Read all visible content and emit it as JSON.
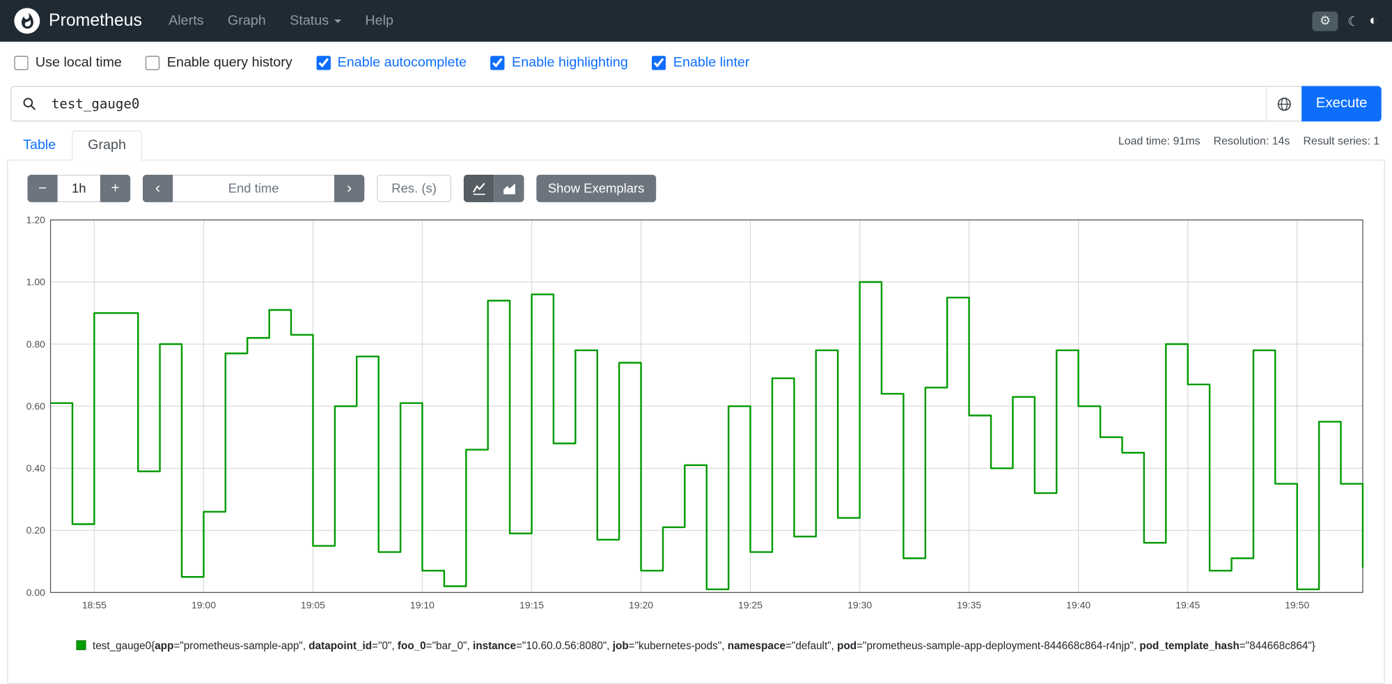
{
  "navbar": {
    "brand": "Prometheus",
    "links": [
      {
        "label": "Alerts"
      },
      {
        "label": "Graph"
      },
      {
        "label": "Status"
      },
      {
        "label": "Help"
      }
    ],
    "theme_icons": {
      "settings": "⚙",
      "moon": "☾",
      "auto": "◐"
    }
  },
  "options": {
    "checkboxes": [
      {
        "label": "Use local time",
        "checked": false
      },
      {
        "label": "Enable query history",
        "checked": false
      },
      {
        "label": "Enable autocomplete",
        "checked": true
      },
      {
        "label": "Enable highlighting",
        "checked": true
      },
      {
        "label": "Enable linter",
        "checked": true
      }
    ]
  },
  "query": {
    "value": "test_gauge0",
    "execute_label": "Execute"
  },
  "stats": {
    "load_time": "Load time: 91ms",
    "resolution": "Resolution: 14s",
    "result_series": "Result series: 1"
  },
  "tabs": {
    "table": "Table",
    "graph": "Graph"
  },
  "controls": {
    "decrease": "−",
    "range": "1h",
    "increase": "+",
    "prev": "‹",
    "next": "›",
    "end_time_placeholder": "End time",
    "res_placeholder": "Res. (s)",
    "show_exemplars": "Show Exemplars"
  },
  "chart_data": {
    "type": "line",
    "step": true,
    "title": "",
    "xlabel": "",
    "ylabel": "",
    "series_name": "test_gauge0",
    "line_color": "#009a00",
    "grid": true,
    "ylim": [
      0,
      1.2
    ],
    "yticks": [
      0,
      0.2,
      0.4,
      0.6,
      0.8,
      1.0,
      1.2
    ],
    "x_start": "18:53",
    "x_end": "19:53",
    "x_step_minutes": 1,
    "xticks": [
      {
        "label": "18:55",
        "index": 2
      },
      {
        "label": "19:00",
        "index": 7
      },
      {
        "label": "19:05",
        "index": 12
      },
      {
        "label": "19:10",
        "index": 17
      },
      {
        "label": "19:15",
        "index": 22
      },
      {
        "label": "19:20",
        "index": 27
      },
      {
        "label": "19:25",
        "index": 32
      },
      {
        "label": "19:30",
        "index": 37
      },
      {
        "label": "19:35",
        "index": 42
      },
      {
        "label": "19:40",
        "index": 47
      },
      {
        "label": "19:45",
        "index": 52
      },
      {
        "label": "19:50",
        "index": 57
      }
    ],
    "values": [
      0.61,
      0.22,
      0.9,
      0.9,
      0.39,
      0.8,
      0.05,
      0.26,
      0.77,
      0.82,
      0.91,
      0.83,
      0.15,
      0.6,
      0.76,
      0.13,
      0.61,
      0.07,
      0.02,
      0.46,
      0.94,
      0.19,
      0.96,
      0.48,
      0.78,
      0.17,
      0.74,
      0.07,
      0.21,
      0.41,
      0.01,
      0.6,
      0.13,
      0.69,
      0.18,
      0.78,
      0.24,
      1.0,
      0.64,
      0.11,
      0.66,
      0.95,
      0.57,
      0.4,
      0.63,
      0.32,
      0.78,
      0.6,
      0.5,
      0.45,
      0.16,
      0.8,
      0.67,
      0.07,
      0.11,
      0.78,
      0.35,
      0.01,
      0.55,
      0.35,
      0.08
    ]
  },
  "legend": {
    "series_color": "#00a000",
    "name": "test_gauge0",
    "labels": [
      {
        "k": "app",
        "v": "prometheus-sample-app"
      },
      {
        "k": "datapoint_id",
        "v": "0"
      },
      {
        "k": "foo_0",
        "v": "bar_0"
      },
      {
        "k": "instance",
        "v": "10.60.0.56:8080"
      },
      {
        "k": "job",
        "v": "kubernetes-pods"
      },
      {
        "k": "namespace",
        "v": "default"
      },
      {
        "k": "pod",
        "v": "prometheus-sample-app-deployment-844668c864-r4njp"
      },
      {
        "k": "pod_template_hash",
        "v": "844668c864"
      }
    ]
  }
}
